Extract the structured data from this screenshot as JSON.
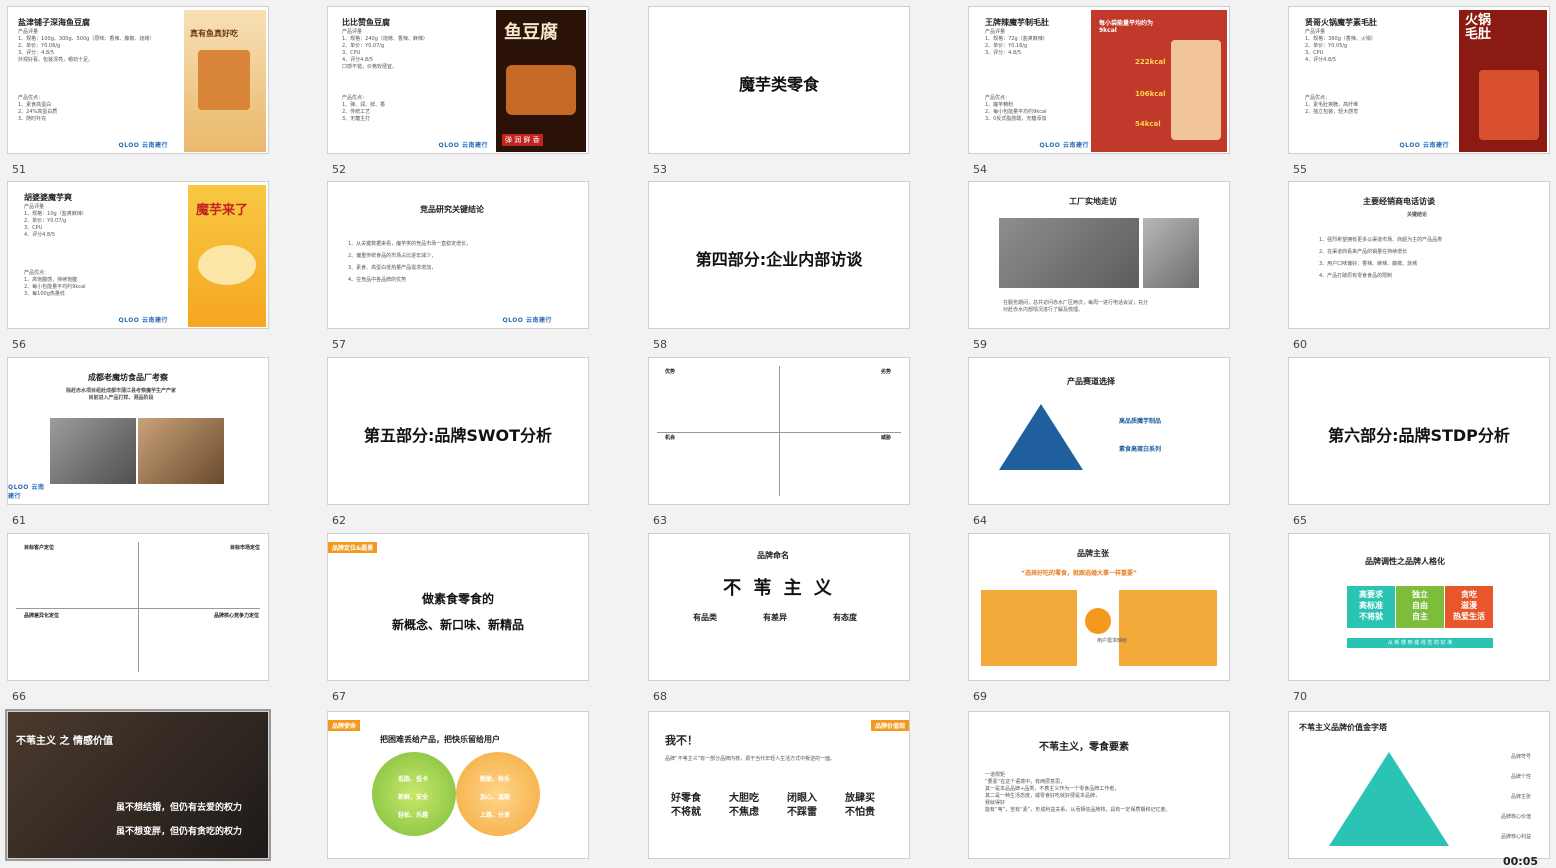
{
  "slides": [
    {
      "num": "51",
      "title": "盐津铺子深海鱼豆腐",
      "img_text": "真有鱼真好吃",
      "text": "产品评量\n1、规格：100g、300g、500g（原味、香辣、藤椒、烧烤）\n2、单价：Y0.06/g\n3、评分：4.8/5\n外观好看、包装漂亮，嚼劲十足。",
      "sub": "产品优点：\n1、素食高蛋白\n2、24%高蛋白质\n3、随时补充"
    },
    {
      "num": "52",
      "title": "比比赞鱼豆腐",
      "img_text": "鱼豆腐",
      "img_sub": "弹 润 鲜 香",
      "text": "产品评量\n1、规格：240g（烧烤、香辣、麻辣）\n2、单价：Y0.07/g\n3、CPU\n4、评分4.8/5\n口感不错，价格较便宜。",
      "sub": "产品优点：\n1、弹、润、鲜、香\n2、传统工艺\n3、无糖主打"
    },
    {
      "num": "53",
      "big": "魔芋类零食"
    },
    {
      "num": "54",
      "title": "王牌辣魔芋制毛肚",
      "img_text": "每小袋能量平均约为9kcal",
      "img_nums": [
        "222kcal",
        "106kcal",
        "54kcal"
      ],
      "text": "产品评量\n1、规格：72g（盐爽麻辣）\n2、单价：Y0.16/g\n3、评分：4.8/5",
      "sub": "产品优点：\n1、魔芋精粉\n2、每小包能量平均约9kcal\n3、0反式脂肪酸，无糖添加"
    },
    {
      "num": "55",
      "title": "贤哥火锅魔芋素毛肚",
      "img_text": "火锅毛肚",
      "text": "产品评量\n1、规格：360g（香辣、火锅）\n2、单价：Y0.05/g\n3、CPU\n4、评分4.8/5",
      "sub": "产品优点：\n1、素毛肚爽脆，高纤维\n2、独立包装，轻大感觉"
    },
    {
      "num": "56",
      "title": "胡婆婆魔芋爽",
      "img_text": "魔芋来了",
      "text": "产品评量\n1、规格：10g（盐爽麻辣）\n2、单价：Y0.07/g\n3、CPU\n4、评分4.8/5",
      "sub": "产品优点：\n1、高饱腹感，持续饱腹\n2、每小包能量平均约9kcal\n3、每100g热量低"
    },
    {
      "num": "57",
      "title": "竞品研究关键结论",
      "text": "1、从关键数据来看，魔芋类的竞品市场一直稳定增长，\n2、偏重传统食品的市场占比逐年减少，\n3、素食、高蛋白低热量产品需求增加，\n4、在竞品中各品牌的优势",
      "sub": ""
    },
    {
      "num": "58",
      "big": "第四部分:企业内部访谈"
    },
    {
      "num": "59",
      "title": "工厂实地走访",
      "text": "在服务期间，总共访问赤水厂区两次，每周一进行电话会议，充分\n对赶赤水内部情况进行了解及梳理。"
    },
    {
      "num": "60",
      "title": "主要经销商电话访谈",
      "sub_title": "关键结论",
      "text": "1、强烈希望拥有更多以渠道市场、商超为主的产品品类\n2、在渠道商看来产品的销量在持续增长\n3、用户口味偏好：香辣、麻辣、藤椒、烧烤\n4、产品打破原有零食食品的限制"
    },
    {
      "num": "61",
      "title": "成都老魔坊食品厂考察",
      "sub_title": "除赶赤水项目组赴成都市蒲江县考察魔芋生产产家\n目前进入产品打样、测品阶段"
    },
    {
      "num": "62",
      "big": "第五部分:品牌SWOT分析"
    },
    {
      "num": "63",
      "quads": [
        "优势",
        "劣势",
        "机会",
        "威胁"
      ]
    },
    {
      "num": "64",
      "title": "产品赛道选择",
      "labels": [
        "高品质魔芋制品",
        "素食高蛋白系列"
      ]
    },
    {
      "num": "65",
      "big": "第六部分:品牌STDP分析"
    },
    {
      "num": "66",
      "quads": [
        "目标客户定位",
        "目标市场定位",
        "品牌差异化定位",
        "品牌核心竞争力定位"
      ]
    },
    {
      "num": "67",
      "tag": "品牌定位&愿景",
      "lines": [
        "做素食零食的",
        "新概念、新口味、新精品"
      ]
    },
    {
      "num": "68",
      "title": "品牌命名",
      "big": "不 苇 主 义",
      "cols": [
        "有品类",
        "有差异",
        "有态度"
      ]
    },
    {
      "num": "69",
      "title": "品牌主张",
      "quote": "“选择好吃的零食，就跟选婚大事一样重要”",
      "side": "用户需求映射"
    },
    {
      "num": "70",
      "title": "品牌调性之品牌人格化",
      "boxes": [
        "高要求\n高标准\n不将就",
        "独立\n自由\n自主",
        "贪吃\n滋漫\n热爱生活"
      ],
      "bar": "从 新 感 到 底 线 性 的 好 演"
    },
    {
      "num": "",
      "title": "不苇主义 之 情感价值",
      "lines": [
        "虽不想结婚，但仍有去爱的权力",
        "虽不想变胖，但仍有贪吃的权力"
      ]
    },
    {
      "num": "",
      "tag": "品牌使命",
      "title": "把困难丢给产品，把快乐留给用户",
      "left": [
        "低脂、低卡",
        "新鲜、安全",
        "轻松、乐趣"
      ],
      "right": [
        "脆脆、快乐",
        "加心、温暖",
        "上路、分享"
      ]
    },
    {
      "num": "",
      "tag": "品牌价值观",
      "title": "我不！",
      "sub": "品牌“不苇主义”有一部分品牌内核，源于当代年轻人生活方式中叛逆的一面。",
      "pairs": [
        "好零食\n不将就",
        "大胆吃\n不焦虑",
        "闭眼入\n不踩雷",
        "放肆买\n不怕贵"
      ]
    },
    {
      "num": "",
      "title": "不苇主义，零食要素",
      "text": "一道规矩\n“要素”在这个语境中，有两层意思，\n其一是本品品牌+品类，不着主义作为一个零食品牌工作者，\n其二是一种生活态度，或零食好吃就好便是本品牌，\n我就得好\n能有“苇”，苦有“素”，形成利益关系，从而相信品牌将，具有一定保质期和记忆度。"
    },
    {
      "num": "",
      "title": "不苇主义品牌价值金字塔",
      "right": [
        "品牌符号",
        "品牌个性",
        "品牌主张",
        "品牌核心价值",
        "品牌核心利益"
      ]
    }
  ],
  "logo": "QLOO 云南建行",
  "clock": "00:05"
}
